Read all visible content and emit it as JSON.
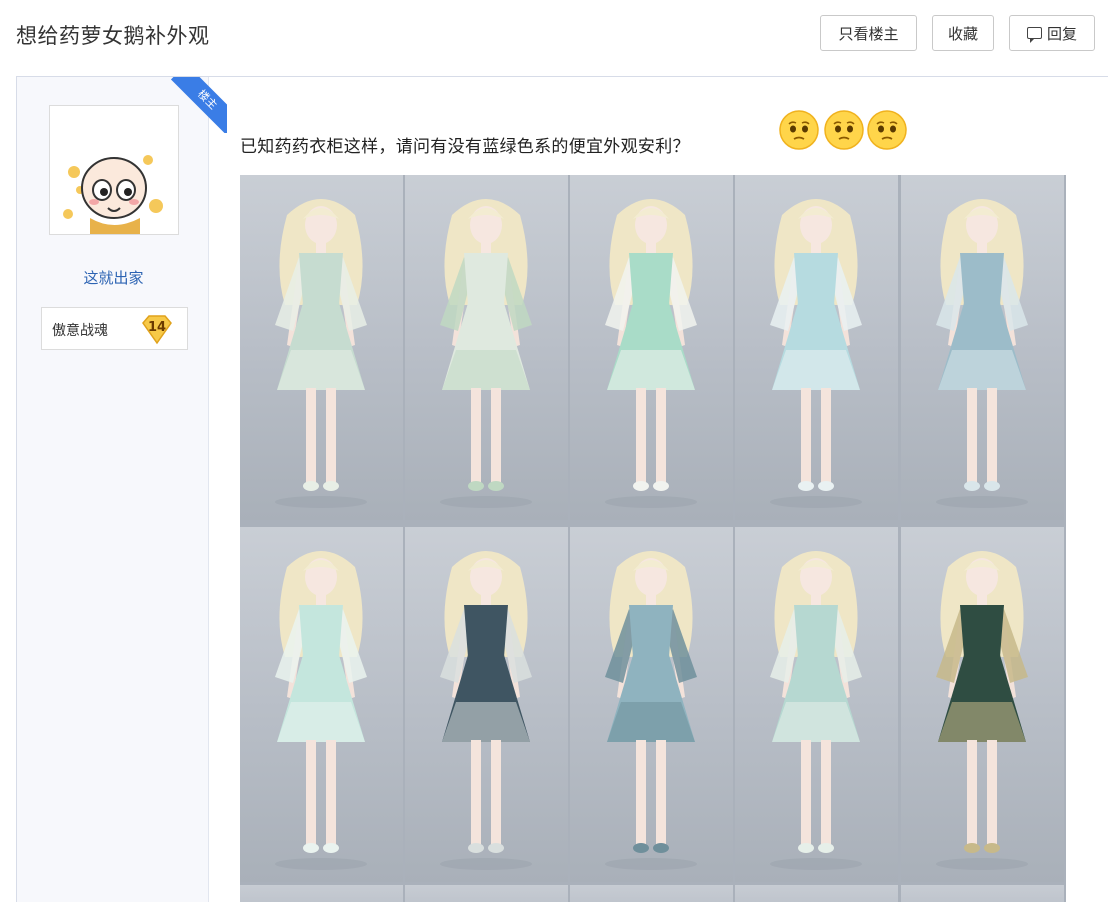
{
  "header": {
    "title": "想给药萝女鹅补外观",
    "only_op_label": "只看楼主",
    "collect_label": "收藏",
    "reply_label": "回复"
  },
  "user": {
    "op_badge": "楼主",
    "name": "这就出家",
    "level_name": "傲意战魂",
    "level": "14"
  },
  "post": {
    "text": "已知药药衣柜这样，请问有没有蓝绿色系的便宜外观安利？",
    "emoji_count": 3
  },
  "outfits": [
    {
      "dress": "#c6dcd0",
      "accent": "#e8efe6"
    },
    {
      "dress": "#dfe9df",
      "accent": "#bfd8c2"
    },
    {
      "dress": "#a9dcc8",
      "accent": "#f1f3ef"
    },
    {
      "dress": "#b6dbe0",
      "accent": "#e9f1f2"
    },
    {
      "dress": "#9cbcc9",
      "accent": "#d9e6ea"
    },
    {
      "dress": "#c4e6dd",
      "accent": "#eaf3ef"
    },
    {
      "dress": "#3f5562",
      "accent": "#d9dfde"
    },
    {
      "dress": "#8fb3bf",
      "accent": "#6f8f9b"
    },
    {
      "dress": "#b6d8d1",
      "accent": "#e6efe9"
    },
    {
      "dress": "#2f4d42",
      "accent": "#c7b98a"
    }
  ]
}
